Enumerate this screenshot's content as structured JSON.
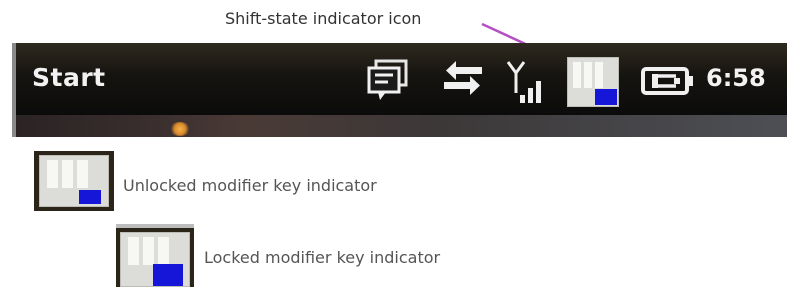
{
  "callout": {
    "label": "Shift-state indicator icon",
    "arrow_color": "#b24fc2"
  },
  "taskbar": {
    "start_label": "Start",
    "clock": "6:58",
    "tray_icons": [
      "notification-icon",
      "sync-arrows-icon",
      "signal-strength-icon",
      "shift-state-icon",
      "battery-charging-icon"
    ]
  },
  "legend": {
    "unlocked_label": "Unlocked modifier key indicator",
    "locked_label": "Locked modifier key indicator"
  },
  "colors": {
    "indicator_blue": "#1616d9",
    "taskbar_dark": "#111111",
    "text_gray": "#555555"
  }
}
